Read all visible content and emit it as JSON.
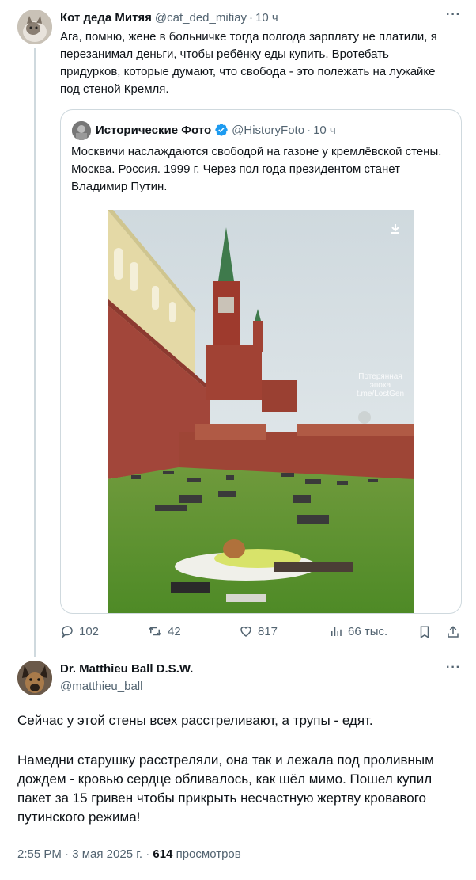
{
  "tweet": {
    "author_name": "Кот деда Митяя",
    "author_handle": "@cat_ded_mitiay",
    "separator": "·",
    "time": "10 ч",
    "more": "···",
    "text": "Ага, помню, жене в больничке тогда полгода зарплату не платили, я перезанимал деньги, чтобы ребёнку еды купить. Вротебать придурков, которые думают, что свобода - это полежать на лужайке под стеной Кремля."
  },
  "quote": {
    "author_name": "Исторические Фото",
    "author_handle": "@HistoryFoto",
    "separator": "·",
    "time": "10 ч",
    "verified_icon": "verified-badge-icon",
    "text": "Москвичи наслаждаются свободой на газоне у кремлёвской стены. Москва. Россия. 1999 г. Через пол года президентом станет Владимир Путин.",
    "photo_watermark_line1": "Потерянная",
    "photo_watermark_line2": "эпоха",
    "photo_watermark_line3": "t.me/LostGen"
  },
  "actions": {
    "replies": "102",
    "reposts": "42",
    "likes": "817",
    "views": "66 тыс."
  },
  "reply": {
    "author_name": "Dr. Matthieu Ball D.S.W.",
    "author_handle": "@matthieu_ball",
    "more": "···",
    "paragraph1": "Сейчас у этой стены всех расстреливают, а трупы - едят.",
    "paragraph2": "Намедни старушку расстреляли, она так и лежала под проливным дождем - кровью сердце обливалось, как шёл мимо. Пошел купил пакет за 15 гривен чтобы прикрыть несчастную жертву кровавого путинского режима!",
    "time": "2:55 PM",
    "sep": "·",
    "date": "3 мая 2025 г.",
    "views_count": "614",
    "views_label": "просмотров"
  },
  "colors": {
    "text": "#0f1419",
    "secondary": "#536471",
    "border": "#cfd9de",
    "verified": "#1d9bf0"
  }
}
